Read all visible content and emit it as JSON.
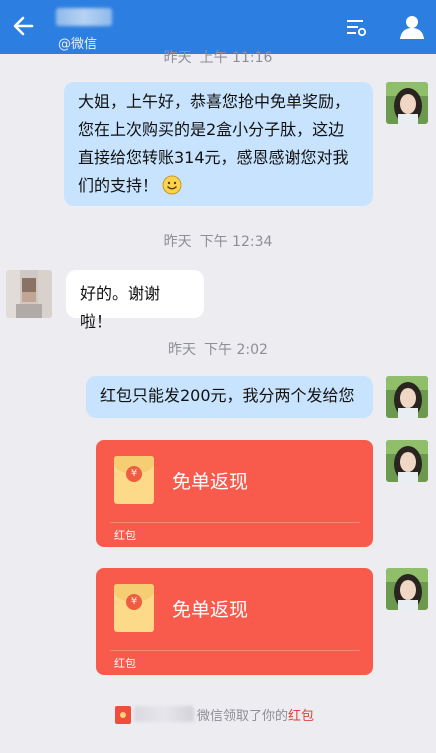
{
  "header": {
    "subtitle": "@微信",
    "accent_color": "#2c7fe0",
    "back_icon": "arrow-left-icon",
    "menu_icon": "list-settings-icon",
    "profile_icon": "user-icon"
  },
  "messages": {
    "timestamp_top": {
      "day": "昨天",
      "time": "上午 11:16"
    },
    "msg1": {
      "lines": [
        "大姐，上午好，恭喜您抢中免单奖励，",
        "您在上次购买的是2盒小分子肽，这边",
        "直接给您转账314元，感恩感谢您对我",
        "们的支持！"
      ],
      "emoji": "smile-emoji-icon"
    },
    "timestamp_2": {
      "day": "昨天",
      "time": "下午 12:34"
    },
    "msg2": {
      "text": "好的。谢谢啦！"
    },
    "timestamp_3": {
      "day": "昨天",
      "time": "下午 2:02"
    },
    "msg3": {
      "text": "红包只能发200元，我分两个发给您"
    },
    "redpacket1": {
      "title": "免单返现",
      "label": "红包",
      "coin_symbol": "¥"
    },
    "redpacket2": {
      "title": "免单返现",
      "label": "红包",
      "coin_symbol": "¥"
    }
  },
  "system": {
    "text": "微信领取了你的",
    "link": "红包"
  },
  "colors": {
    "bubble_sent": "#c8e3fd",
    "redpacket": "#f85a4c",
    "background": "#ececf1"
  }
}
